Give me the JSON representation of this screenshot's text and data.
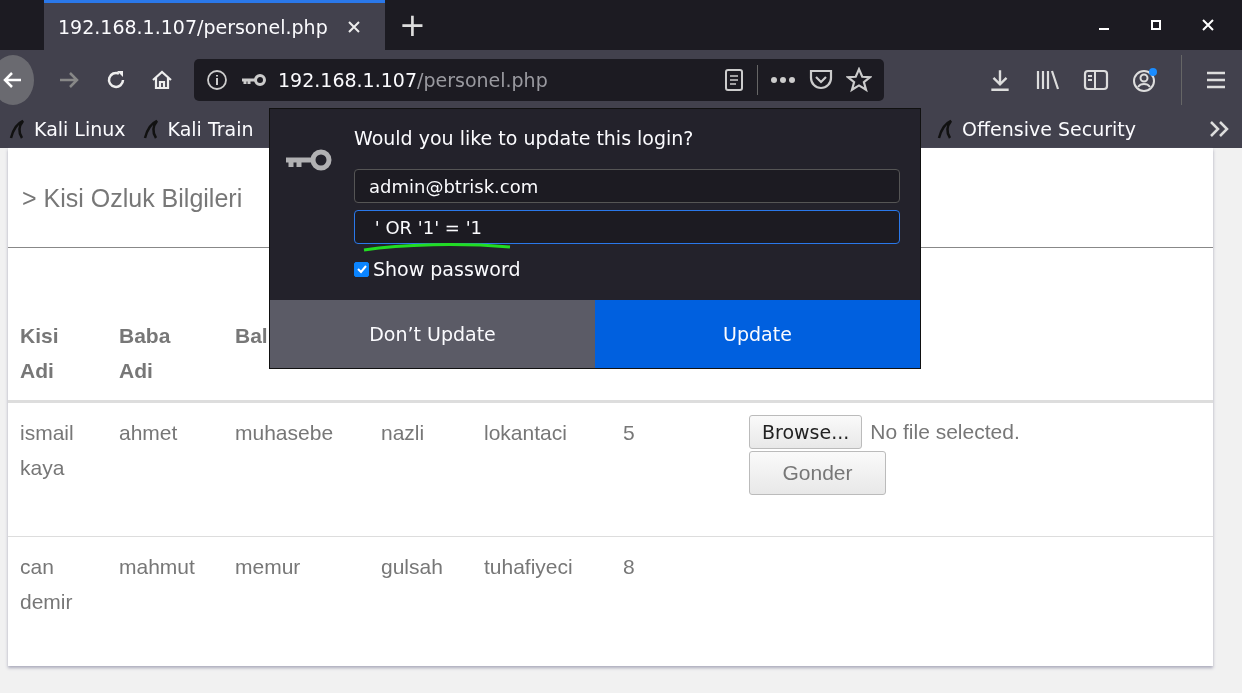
{
  "tabs": [
    {
      "title": "192.168.1.107/personel.php",
      "selected": true
    }
  ],
  "new_tab": "+",
  "url": {
    "host": "192.168.1.107",
    "path": "/personel.php"
  },
  "bookmarks": [
    {
      "label": "Kali Linux"
    },
    {
      "label": "Kali Train"
    },
    {
      "label": "Offensive Security"
    }
  ],
  "login_popup": {
    "title": "Would you like to update this login?",
    "username": "admin@btrisk.com",
    "password": " ' OR '1' = '1",
    "show_password": {
      "label": "Show password",
      "checked": true
    },
    "buttons": [
      {
        "label": "Don’t Update",
        "kind": "secondary"
      },
      {
        "label": "Update",
        "kind": "primary"
      }
    ]
  },
  "page": {
    "heading": "> Kisi Ozluk Bilgileri",
    "table": {
      "columns": [
        "Kisi Adi",
        "Baba Adi",
        "Bal"
      ],
      "rows": [
        {
          "cells": [
            "ismail kaya",
            "ahmet",
            "muhasebe",
            "nazli",
            "lokantaci",
            "5"
          ],
          "upload": {
            "browse": "Browse...",
            "status": "No file selected.",
            "submit": "Gonder"
          }
        },
        {
          "cells": [
            "can demir",
            "mahmut",
            "memur",
            "gulsah",
            "tuhafiyeci",
            "8"
          ]
        }
      ]
    }
  }
}
